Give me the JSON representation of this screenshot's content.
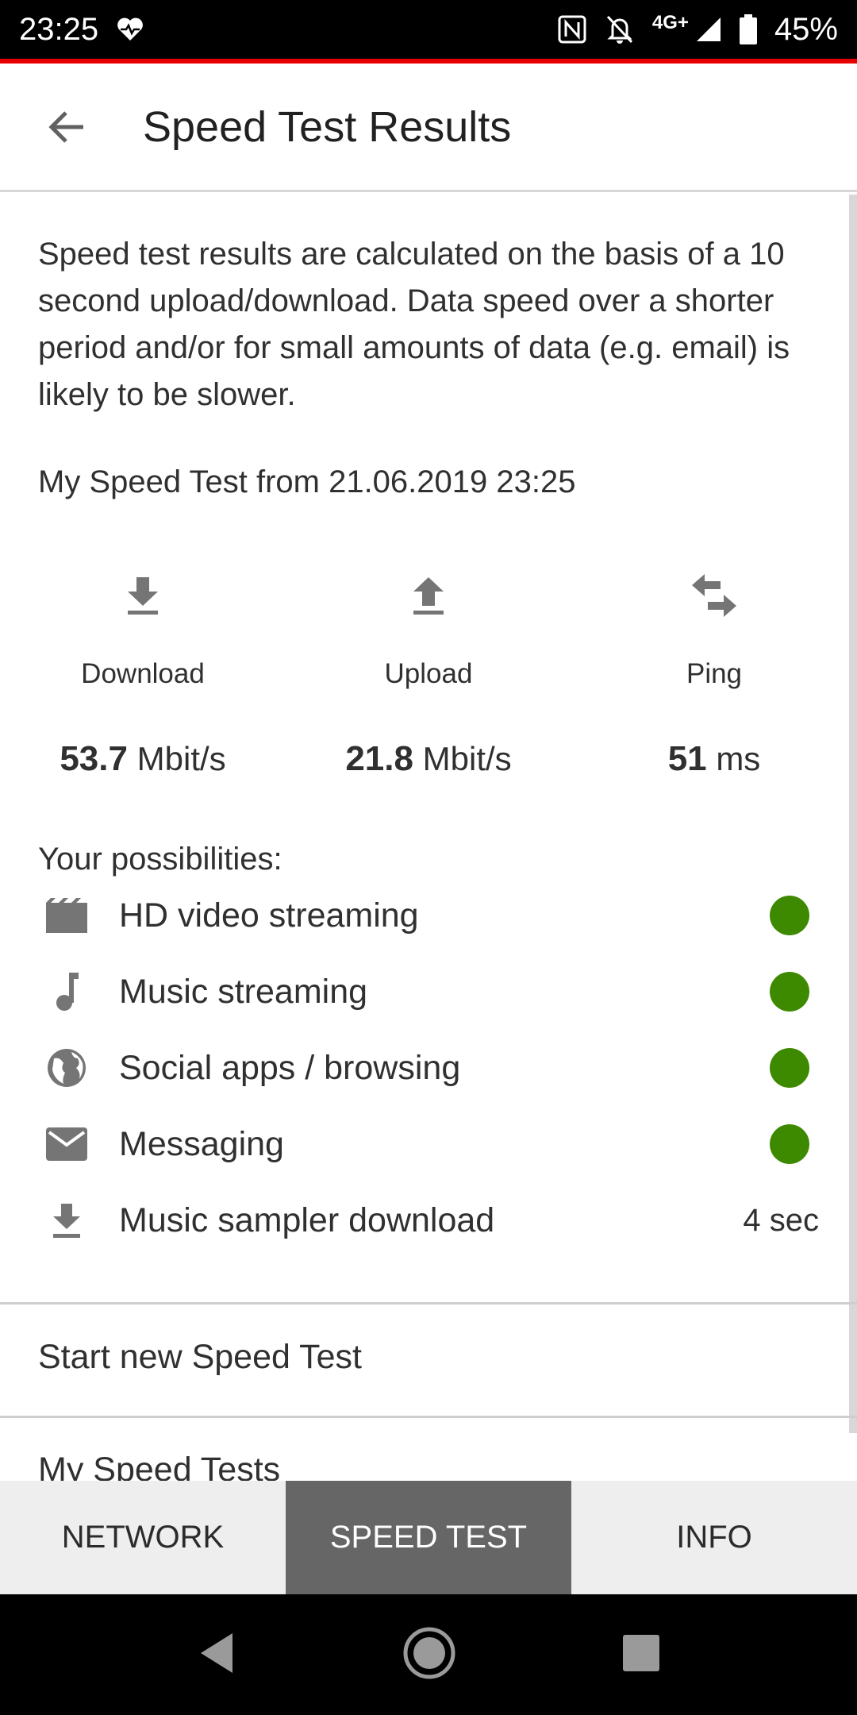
{
  "status_bar": {
    "time": "23:25",
    "network": "4G+",
    "battery": "45%"
  },
  "app_bar": {
    "title": "Speed Test Results"
  },
  "content": {
    "info_text": "Speed test results are calculated on the basis of a 10 second upload/download. Data speed over a shorter period and/or for small amounts of data (e.g. email) is likely to be slower.",
    "test_date": "My Speed Test from 21.06.2019 23:25",
    "metrics": [
      {
        "label": "Download",
        "value": "53.7",
        "unit": "Mbit/s",
        "icon": "download-icon"
      },
      {
        "label": "Upload",
        "value": "21.8",
        "unit": "Mbit/s",
        "icon": "upload-icon"
      },
      {
        "label": "Ping",
        "value": "51",
        "unit": "ms",
        "icon": "swap-arrows-icon"
      }
    ],
    "possibilities_title": "Your possibilities:",
    "possibilities": [
      {
        "label": "HD video streaming",
        "icon": "movie-clapper-icon",
        "status_color": "#3d8a00"
      },
      {
        "label": "Music streaming",
        "icon": "music-note-icon",
        "status_color": "#3d8a00"
      },
      {
        "label": "Social apps / browsing",
        "icon": "globe-icon",
        "status_color": "#3d8a00"
      },
      {
        "label": "Messaging",
        "icon": "mail-icon",
        "status_color": "#3d8a00"
      },
      {
        "label": "Music sampler download",
        "icon": "download-icon",
        "value": "4 sec"
      }
    ],
    "menu": {
      "start_new": "Start new Speed Test",
      "my_tests": "My Speed Tests"
    }
  },
  "bottom_tabs": {
    "items": [
      {
        "label": "NETWORK",
        "active": false
      },
      {
        "label": "SPEED TEST",
        "active": true
      },
      {
        "label": "INFO",
        "active": false
      }
    ]
  },
  "colors": {
    "accent_red": "#e60000",
    "status_green": "#3d8a00",
    "active_tab": "#666666"
  }
}
